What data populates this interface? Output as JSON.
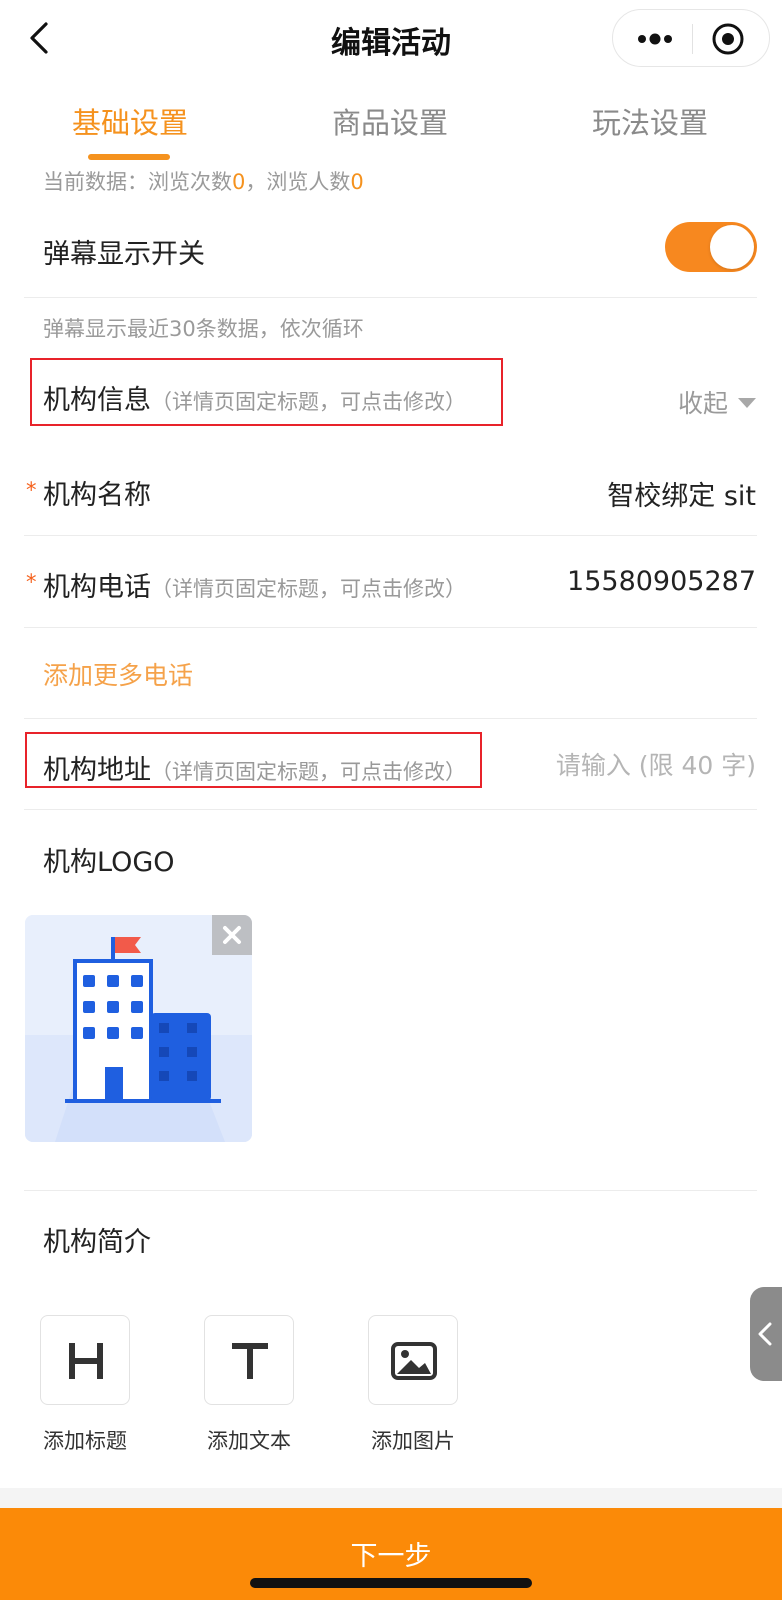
{
  "nav": {
    "title": "编辑活动"
  },
  "tabs": [
    {
      "label": "基础设置",
      "active": true
    },
    {
      "label": "商品设置",
      "active": false
    },
    {
      "label": "玩法设置",
      "active": false
    }
  ],
  "stats": {
    "prefix": "当前数据：浏览次数",
    "views": "0",
    "sep": "，浏览人数",
    "visitors": "0"
  },
  "danmaku": {
    "label": "弹幕显示开关",
    "enabled": true,
    "note": "弹幕显示最近30条数据，依次循环"
  },
  "org_info": {
    "label": "机构信息",
    "hint": "（详情页固定标题，可点击修改）",
    "collapse_label": "收起"
  },
  "org_name": {
    "required_mark": "*",
    "label": "机构名称",
    "value": "智校绑定 sit"
  },
  "org_phone": {
    "required_mark": "*",
    "label": "机构电话",
    "hint": "（详情页固定标题，可点击修改）",
    "value": "15580905287"
  },
  "add_phone": {
    "label": "添加更多电话"
  },
  "org_address": {
    "label": "机构地址",
    "hint": "（详情页固定标题，可点击修改）",
    "placeholder": "请输入 (限 40 字)"
  },
  "org_logo": {
    "label": "机构LOGO"
  },
  "org_intro": {
    "label": "机构简介",
    "tools": [
      {
        "label": "添加标题",
        "icon": "heading-icon",
        "glyph": "H"
      },
      {
        "label": "添加文本",
        "icon": "text-icon",
        "glyph": "T"
      },
      {
        "label": "添加图片",
        "icon": "image-icon"
      }
    ]
  },
  "footer": {
    "next_label": "下一步"
  },
  "colors": {
    "accent": "#f5921e",
    "button": "#fb8a08",
    "highlight_box": "#e8232a"
  }
}
